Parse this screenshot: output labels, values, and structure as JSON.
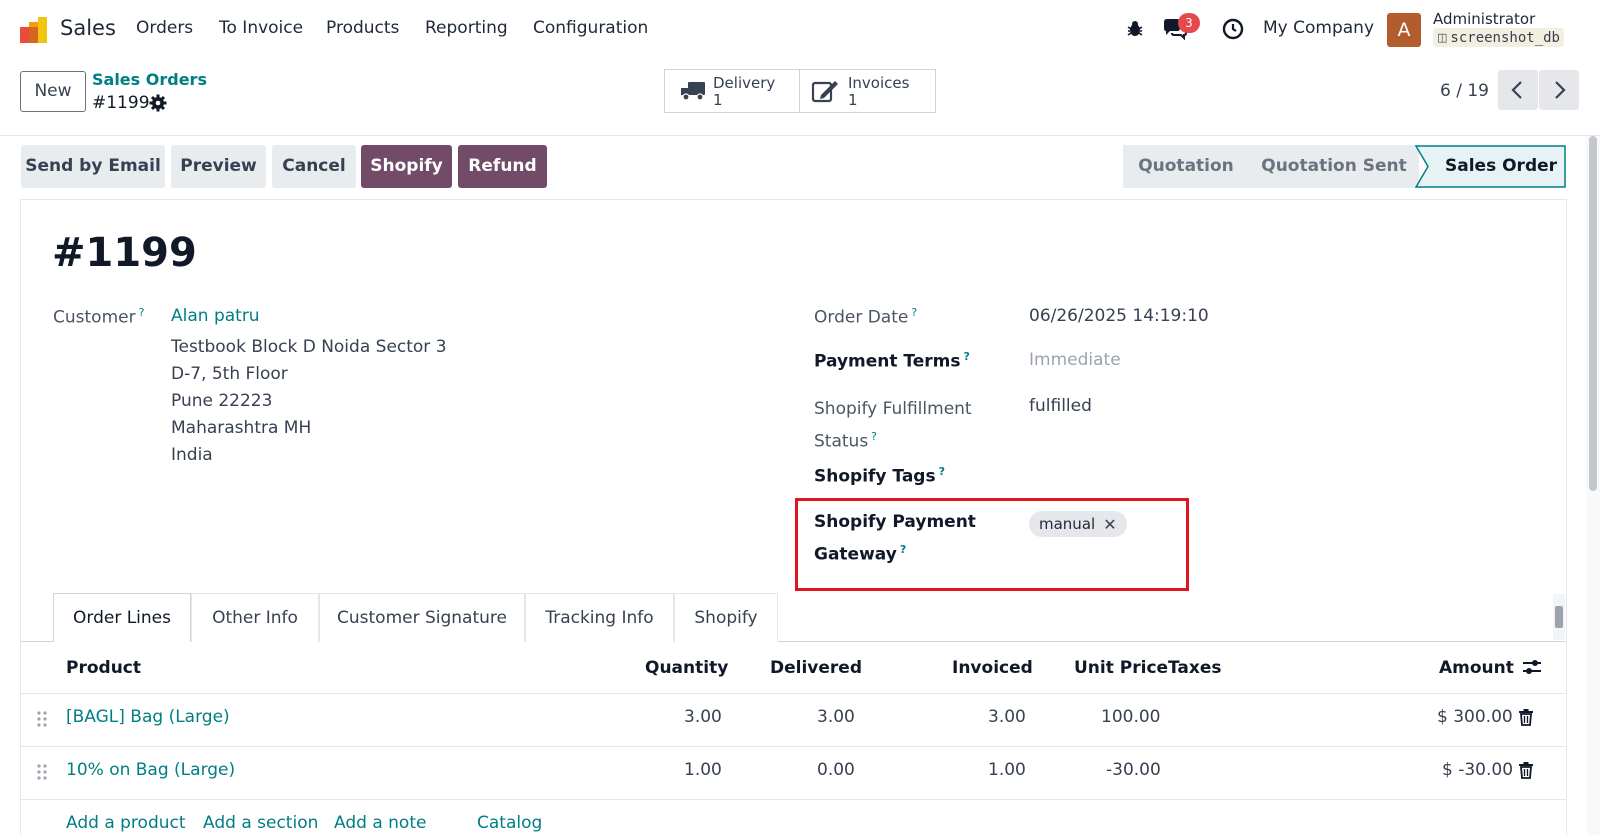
{
  "navbar": {
    "app_name": "Sales",
    "menu": [
      "Orders",
      "To Invoice",
      "Products",
      "Reporting",
      "Configuration"
    ],
    "messages_count": "3",
    "company": "My Company",
    "user_initial": "A",
    "user_name": "Administrator",
    "db_name": "screenshot_db"
  },
  "control_panel": {
    "new_label": "New",
    "breadcrumb_parent": "Sales Orders",
    "record_name": "#1199",
    "smart_buttons": [
      {
        "label": "Delivery",
        "count": "1"
      },
      {
        "label": "Invoices",
        "count": "1"
      }
    ],
    "pager": "6 / 19"
  },
  "actions": {
    "send_email": "Send by Email",
    "preview": "Preview",
    "cancel": "Cancel",
    "shopify": "Shopify",
    "refund": "Refund"
  },
  "stages": [
    "Quotation",
    "Quotation Sent",
    "Sales Order"
  ],
  "form": {
    "title": "#1199",
    "customer_label": "Customer",
    "customer_name": "Alan patru",
    "address": [
      "Testbook Block D Noida Sector 3",
      "D-7, 5th Floor",
      "Pune 22223",
      "Maharashtra MH",
      "India"
    ],
    "order_date_label": "Order Date",
    "order_date": "06/26/2025 14:19:10",
    "payment_terms_label": "Payment Terms",
    "payment_terms": "Immediate",
    "fulfillment_label_1": "Shopify Fulfillment",
    "fulfillment_label_2": "Status",
    "fulfillment_value": "fulfilled",
    "tags_label": "Shopify Tags",
    "gateway_label_1": "Shopify Payment",
    "gateway_label_2": "Gateway",
    "gateway_tag": "manual"
  },
  "tabs": [
    "Order Lines",
    "Other Info",
    "Customer Signature",
    "Tracking Info",
    "Shopify"
  ],
  "table": {
    "headers": {
      "product": "Product",
      "quantity": "Quantity",
      "delivered": "Delivered",
      "invoiced": "Invoiced",
      "unit_price": "Unit Price",
      "taxes": "Taxes",
      "amount": "Amount"
    },
    "rows": [
      {
        "product": "[BAGL] Bag (Large)",
        "quantity": "3.00",
        "delivered": "3.00",
        "invoiced": "3.00",
        "unit_price": "100.00",
        "amount": "$ 300.00"
      },
      {
        "product": "10% on Bag (Large)",
        "quantity": "1.00",
        "delivered": "0.00",
        "invoiced": "1.00",
        "unit_price": "-30.00",
        "amount": "$ -30.00"
      }
    ],
    "add_product": "Add a product",
    "add_section": "Add a section",
    "add_note": "Add a note",
    "catalog": "Catalog"
  },
  "colors": {
    "primary": "#714b67",
    "link": "#017e84",
    "highlight": "#e0141e"
  }
}
